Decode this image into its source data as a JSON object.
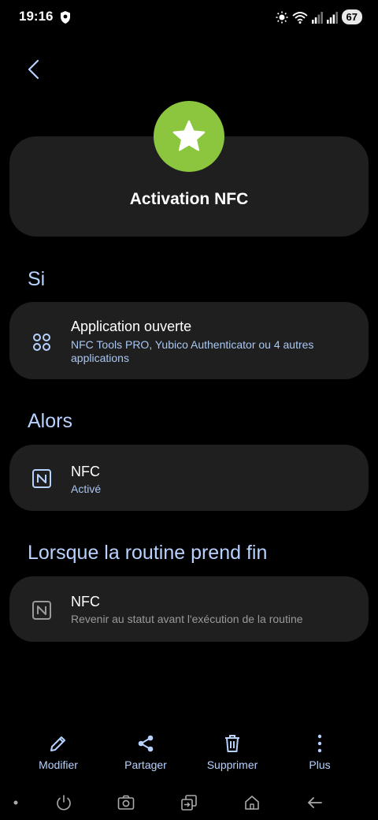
{
  "status_bar": {
    "time": "19:16",
    "battery": "67",
    "icons": [
      "shield-icon",
      "brightness-icon",
      "wifi-icon",
      "signal-icon",
      "signal-icon"
    ]
  },
  "header": {
    "back_icon": "chevron-left-icon"
  },
  "routine": {
    "icon": "star-icon",
    "icon_color": "#8cc63f",
    "title": "Activation NFC"
  },
  "sections": {
    "if": {
      "title": "Si",
      "item": {
        "icon": "apps-grid-icon",
        "title": "Application ouverte",
        "subtitle": "NFC Tools PRO, Yubico Authenticator ou 4 autres applications"
      }
    },
    "then": {
      "title": "Alors",
      "item": {
        "icon": "nfc-icon",
        "title": "NFC",
        "subtitle": "Activé"
      }
    },
    "end": {
      "title": "Lorsque la routine prend fin",
      "item": {
        "icon": "nfc-icon",
        "title": "NFC",
        "subtitle": "Revenir au statut avant l'exécution de la routine"
      }
    }
  },
  "actions": {
    "edit": "Modifier",
    "share": "Partager",
    "delete": "Supprimer",
    "more": "Plus"
  },
  "colors": {
    "background": "#000000",
    "card": "#1f1f1f",
    "accent": "#b8d2ff"
  }
}
